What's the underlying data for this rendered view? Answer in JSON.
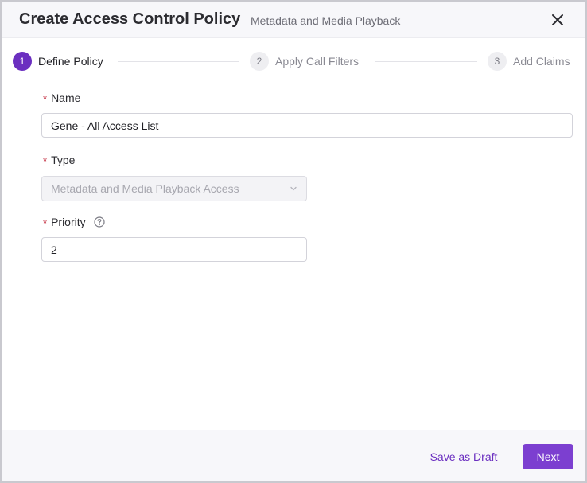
{
  "header": {
    "title": "Create Access Control Policy",
    "subtitle": "Metadata and Media Playback",
    "close_icon": "close-icon"
  },
  "stepper": {
    "steps": [
      {
        "number": "1",
        "label": "Define Policy",
        "state": "active"
      },
      {
        "number": "2",
        "label": "Apply Call Filters",
        "state": "inactive"
      },
      {
        "number": "3",
        "label": "Add Claims",
        "state": "inactive"
      }
    ]
  },
  "form": {
    "name": {
      "label": "Name",
      "required_mark": "*",
      "value": "Gene - All Access List"
    },
    "type": {
      "label": "Type",
      "required_mark": "*",
      "value": "Metadata and Media Playback Access",
      "disabled": true
    },
    "priority": {
      "label": "Priority",
      "required_mark": "*",
      "value": "2",
      "help_icon": "question-circle-icon"
    }
  },
  "footer": {
    "save_draft_label": "Save as Draft",
    "next_label": "Next"
  },
  "colors": {
    "accent": "#7c3fd0",
    "accent_dark": "#6b2fc0",
    "required": "#c2273a"
  }
}
